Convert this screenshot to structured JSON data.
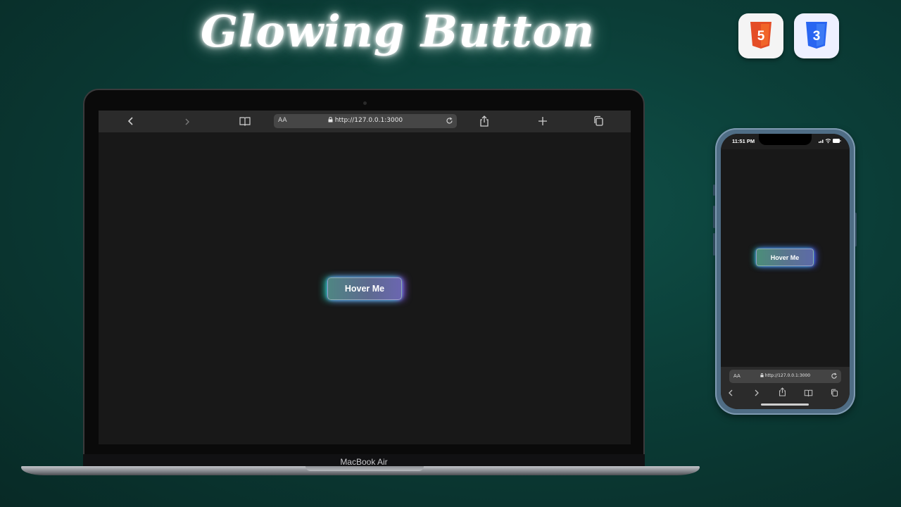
{
  "title": "Glowing Button",
  "badges": {
    "html": {
      "icon": "html5-icon",
      "label": "5",
      "color": "#e44d26"
    },
    "css": {
      "icon": "css3-icon",
      "label": "3",
      "color": "#2965f1"
    }
  },
  "laptop": {
    "label": "MacBook Air",
    "browser": {
      "address_prefix": "AA",
      "url": "http://127.0.0.1:3000",
      "icons": [
        "back-icon",
        "forward-icon",
        "bookmarks-icon",
        "lock-icon",
        "reload-icon",
        "share-icon",
        "new-tab-icon",
        "tabs-icon"
      ]
    },
    "button_label": "Hover Me"
  },
  "phone": {
    "status_time": "11:51 PM",
    "button_label": "Hover Me",
    "address_prefix": "AA",
    "url": "http://127.0.0.1:3000",
    "icons": [
      "back-icon",
      "forward-icon",
      "share-icon",
      "bookmarks-icon",
      "tabs-icon"
    ]
  },
  "colors": {
    "background": "#0b3d37",
    "glow_cyan": "#28e6c8",
    "glow_purple": "#965aff",
    "screen_bg": "#181818"
  }
}
